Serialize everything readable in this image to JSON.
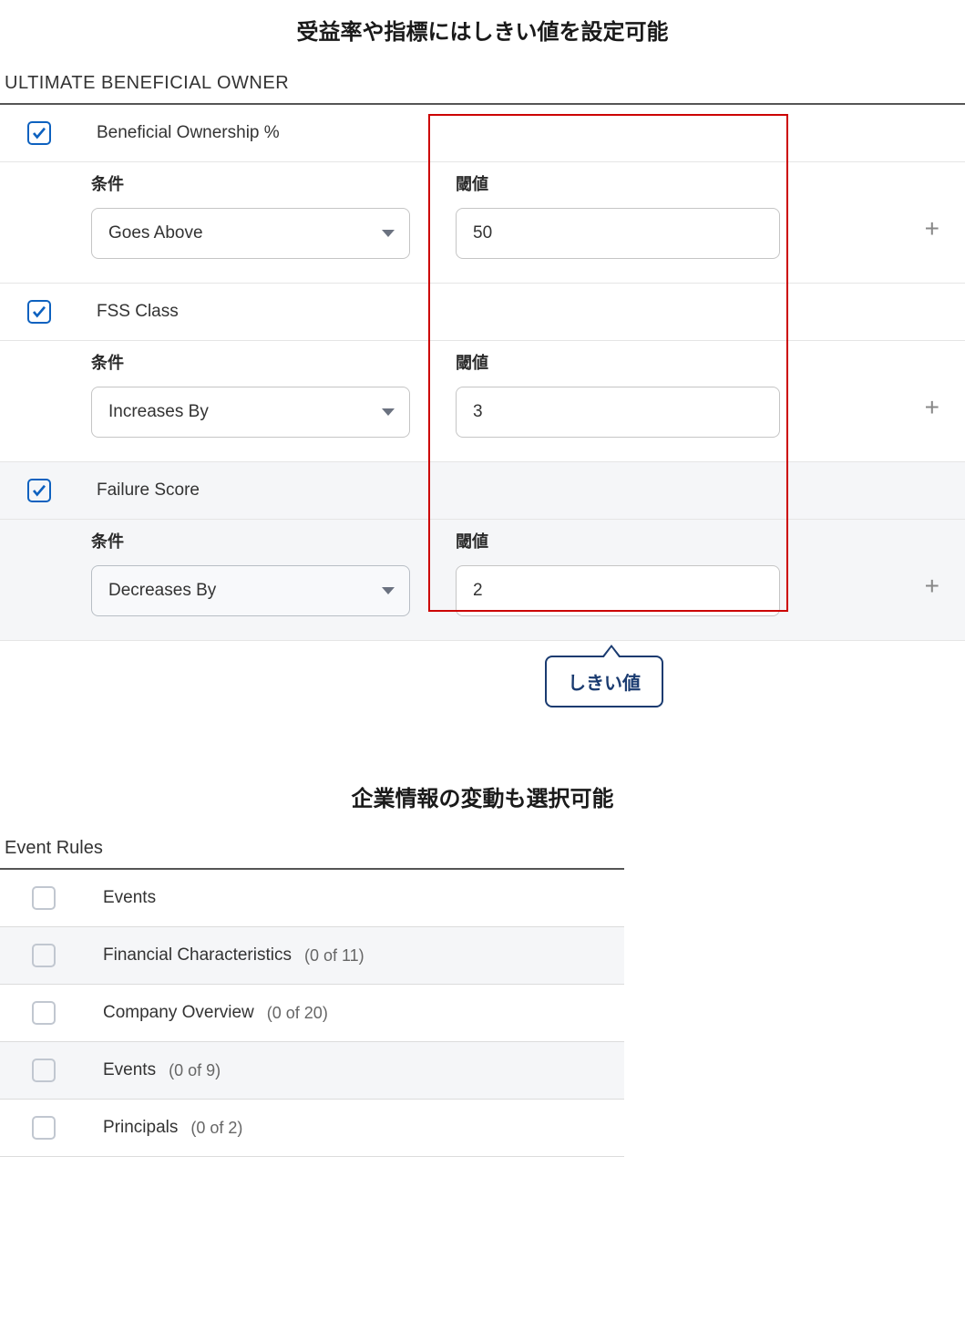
{
  "titles": {
    "section1_title": "受益率や指標にはしきい値を設定可能",
    "section1_header": "ULTIMATE BENEFICIAL OWNER",
    "callout": "しきい値",
    "section2_title": "企業情報の変動も選択可能",
    "section2_header": "Event Rules"
  },
  "labels": {
    "condition": "条件",
    "threshold": "閾値"
  },
  "rules": [
    {
      "name": "Beneficial Ownership %",
      "condition": "Goes Above",
      "threshold": "50",
      "shaded": false
    },
    {
      "name": "FSS Class",
      "condition": "Increases By",
      "threshold": "3",
      "shaded": false
    },
    {
      "name": "Failure Score",
      "condition": "Decreases By",
      "threshold": "2",
      "shaded": true
    }
  ],
  "events": [
    {
      "label": "Events",
      "count": "",
      "shaded": false
    },
    {
      "label": "Financial Characteristics",
      "count": "(0 of 11)",
      "shaded": true
    },
    {
      "label": "Company Overview",
      "count": "(0 of 20)",
      "shaded": false
    },
    {
      "label": "Events",
      "count": "(0 of 9)",
      "shaded": true
    },
    {
      "label": "Principals",
      "count": "(0 of 2)",
      "shaded": false
    }
  ]
}
